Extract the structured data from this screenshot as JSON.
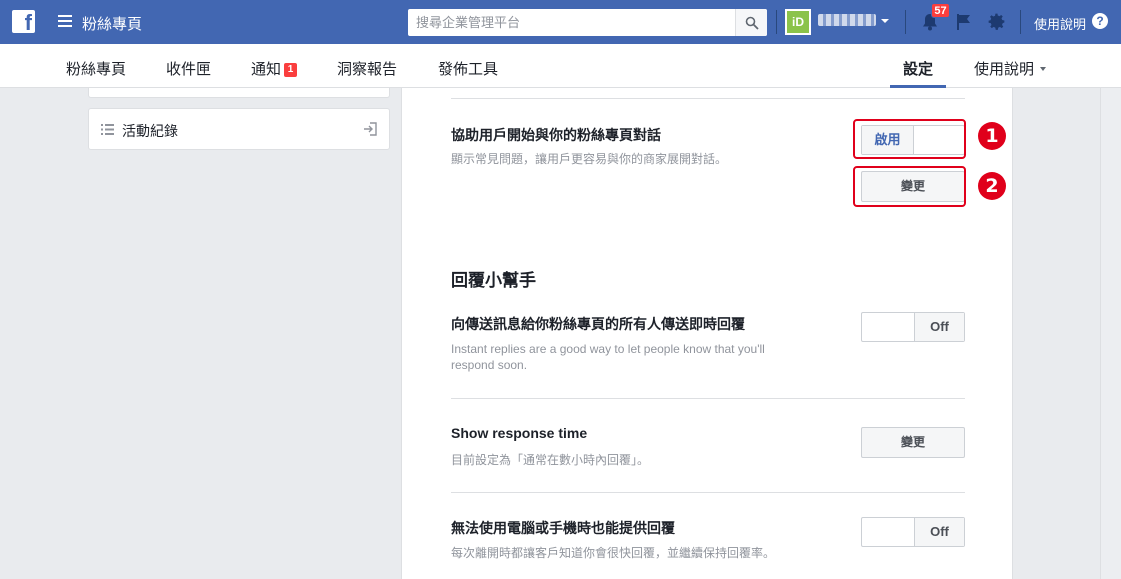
{
  "topbar": {
    "logo": "f",
    "page_name": "粉絲專頁",
    "search_placeholder": "搜尋企業管理平台",
    "avatar_text": "iD",
    "notification_count": "57",
    "help_label": "使用說明",
    "help_icon_text": "?"
  },
  "subnav": {
    "items": [
      "粉絲專頁",
      "收件匣",
      "通知",
      "洞察報告",
      "發佈工具"
    ],
    "notif_badge": "1",
    "settings": "設定",
    "help": "使用說明"
  },
  "sidebar": {
    "activity_log": "活動紀錄"
  },
  "settings": {
    "assist": {
      "title": "協助用戶開始與你的粉絲專頁對話",
      "desc": "顯示常見問題，讓用戶更容易與你的商家展開對話。",
      "toggle_on": "啟用",
      "change_button": "變更"
    },
    "section_title": "回覆小幫手",
    "instant": {
      "title": "向傳送訊息給你粉絲專頁的所有人傳送即時回覆",
      "desc": "Instant replies are a good way to let people know that you'll respond soon.",
      "toggle_off": "Off"
    },
    "response_time": {
      "title": "Show response time",
      "desc": "目前設定為「通常在數小時內回覆」。",
      "change_button": "變更"
    },
    "away": {
      "title": "無法使用電腦或手機時也能提供回覆",
      "desc": "每次離開時都讓客戶知道你會很快回覆，並繼續保持回覆率。",
      "toggle_off": "Off"
    }
  },
  "annotations": {
    "marker_1": "1",
    "marker_2": "2"
  },
  "colors": {
    "topbar": "#4267b2",
    "highlight": "#e0001b",
    "badge": "#fa3e3e"
  }
}
